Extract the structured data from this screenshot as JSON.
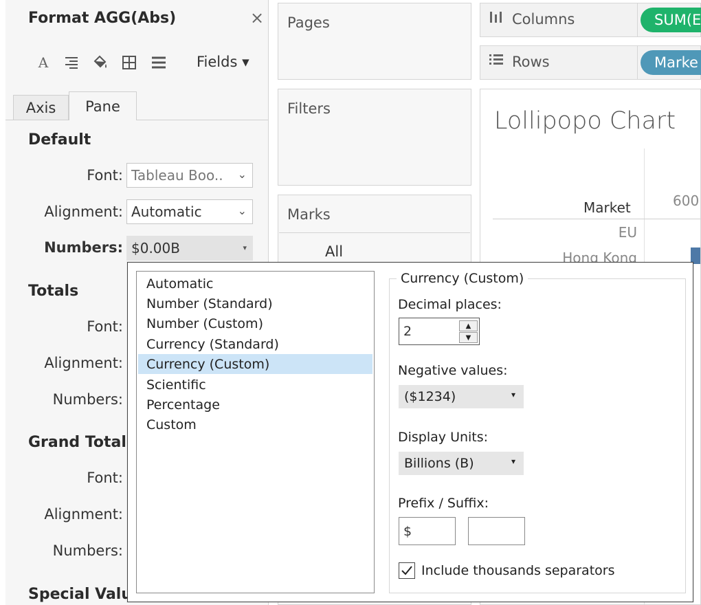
{
  "format_pane": {
    "title": "Format AGG(Abs)",
    "close_glyph": "×",
    "toolbar": {
      "icons": [
        "font-icon",
        "align-icon",
        "shading-icon",
        "borders-icon",
        "lines-icon"
      ],
      "fields_label": "Fields ▾"
    },
    "tabs": [
      {
        "label": "Axis",
        "active": false
      },
      {
        "label": "Pane",
        "active": true
      }
    ],
    "sections": {
      "default": {
        "heading": "Default",
        "font_label": "Font:",
        "font_value": "Tableau Boo..",
        "alignment_label": "Alignment:",
        "alignment_value": "Automatic",
        "numbers_label": "Numbers:",
        "numbers_value": "$0.00B"
      },
      "totals": {
        "heading": "Totals",
        "font_label": "Font:",
        "alignment_label": "Alignment:",
        "numbers_label": "Numbers:"
      },
      "grand_totals": {
        "heading": "Grand Totals",
        "font_label": "Font:",
        "alignment_label": "Alignment:",
        "numbers_label": "Numbers:"
      },
      "special_values": {
        "heading": "Special Valu"
      }
    }
  },
  "shelves": {
    "pages": "Pages",
    "filters": "Filters",
    "marks": "Marks",
    "marks_all": "All"
  },
  "view": {
    "columns_label": "Columns",
    "columns_pill": "SUM(E",
    "rows_label": "Rows",
    "rows_pill": "Marke",
    "title": "Lollipopo Chart",
    "market_header": "Market",
    "axis_tick": "600",
    "markets": [
      "EU",
      "Hong Kong"
    ],
    "colors": {
      "green_pill": "#1fb36b",
      "blue_pill": "#4f98b8",
      "bar": "#4e79a7"
    }
  },
  "number_format_popup": {
    "formats": [
      "Automatic",
      "Number (Standard)",
      "Number (Custom)",
      "Currency (Standard)",
      "Currency (Custom)",
      "Scientific",
      "Percentage",
      "Custom"
    ],
    "selected_format": "Currency (Custom)",
    "options_title": "Currency (Custom)",
    "decimal_places_label": "Decimal places:",
    "decimal_places_value": "2",
    "negative_values_label": "Negative values:",
    "negative_values_value": "($1234)",
    "display_units_label": "Display Units:",
    "display_units_value": "Billions (B)",
    "prefix_suffix_label": "Prefix / Suffix:",
    "prefix_value": "$",
    "suffix_value": "",
    "thousands_separator_label": "Include thousands separators",
    "thousands_separator_checked": true,
    "selection_color": "#cce4f7"
  }
}
